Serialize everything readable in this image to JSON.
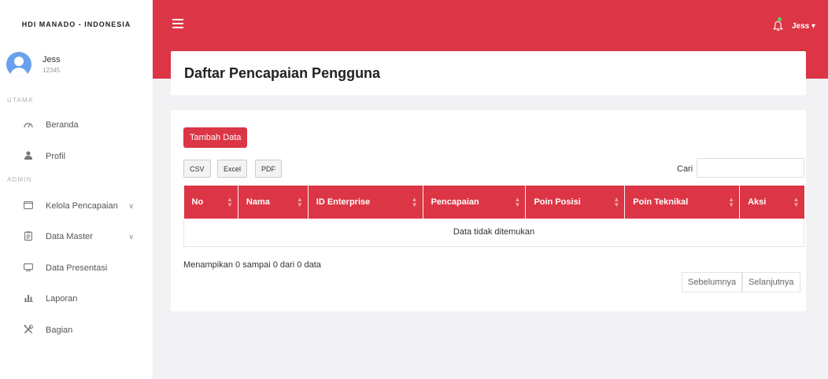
{
  "brand": "HDI MANADO - INDONESIA",
  "user": {
    "name": "Jess",
    "id": "12345"
  },
  "sections": {
    "main": "UTAMA",
    "admin": "ADMIN"
  },
  "nav": {
    "beranda": "Beranda",
    "profil": "Profil",
    "kelola": "Kelola Pencapaian",
    "master": "Data Master",
    "presentasi": "Data Presentasi",
    "laporan": "Laporan",
    "bagian": "Bagian"
  },
  "topbar": {
    "user_menu": "Jess ▾"
  },
  "page": {
    "title": "Daftar Pencapaian Pengguna"
  },
  "toolbar": {
    "add_label": "Tambah Data",
    "csv": "CSV",
    "excel": "Excel",
    "pdf": "PDF",
    "search_label": "Cari"
  },
  "table": {
    "columns": [
      "No",
      "Nama",
      "ID Enterprise",
      "Pencapaian",
      "Poin Posisi",
      "Poin Teknikal",
      "Aksi"
    ],
    "empty_text": "Data tidak ditemukan"
  },
  "info": "Menampikan 0 sampai 0 dari 0 data",
  "pagination": {
    "prev": "Sebelumnya",
    "next": "Selanjutnya"
  },
  "colors": {
    "accent": "#dc3545",
    "background": "#f2f2f4"
  }
}
